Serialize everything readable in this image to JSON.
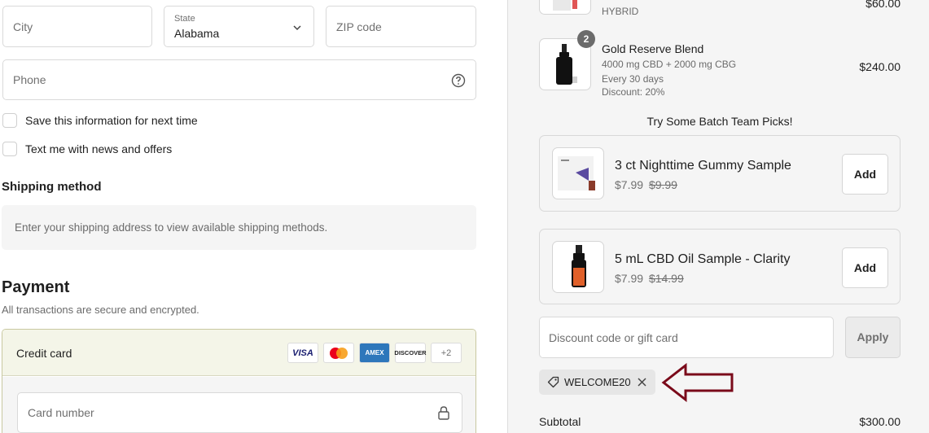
{
  "address": {
    "city_placeholder": "City",
    "state_label": "State",
    "state_value": "Alabama",
    "zip_placeholder": "ZIP code",
    "phone_placeholder": "Phone"
  },
  "options": {
    "save_info": "Save this information for next time",
    "text_offers": "Text me with news and offers"
  },
  "shipping": {
    "title": "Shipping method",
    "message": "Enter your shipping address to view available shipping methods."
  },
  "payment": {
    "title": "Payment",
    "subtitle": "All transactions are secure and encrypted.",
    "method_label": "Credit card",
    "card_brands": [
      "VISA",
      "mastercard",
      "AMEX",
      "DISCOVER"
    ],
    "more_brands": "+2",
    "card_number_placeholder": "Card number"
  },
  "cart": {
    "items": [
      {
        "subtitle": "HYBRID",
        "price": "$60.00"
      },
      {
        "name": "Gold Reserve Blend",
        "qty": "2",
        "meta1": "4000 mg CBD + 2000 mg CBG",
        "meta2": "Every 30 days",
        "meta3": "Discount: 20%",
        "price": "$240.00"
      }
    ]
  },
  "upsells": {
    "title": "Try Some Batch Team Picks!",
    "items": [
      {
        "name": "3 ct Nighttime Gummy Sample",
        "price": "$7.99",
        "compare": "$9.99",
        "button": "Add"
      },
      {
        "name": "5 mL CBD Oil Sample - Clarity",
        "price": "$7.99",
        "compare": "$14.99",
        "button": "Add"
      }
    ]
  },
  "discount": {
    "placeholder": "Discount code or gift card",
    "apply_label": "Apply",
    "applied_code": "WELCOME20"
  },
  "summary": {
    "subtotal_label": "Subtotal",
    "subtotal_value": "$300.00"
  },
  "colors": {
    "annotation_arrow": "#7a0a1a",
    "selected_payment_bg": "#f4f5e8",
    "right_panel_bg": "#f5f5f5"
  }
}
